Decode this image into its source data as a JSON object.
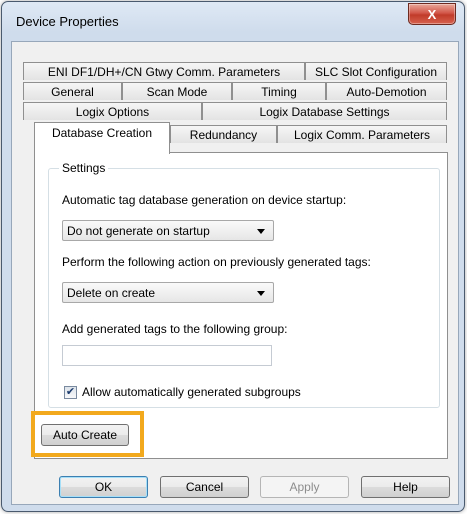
{
  "window": {
    "title": "Device Properties",
    "close_glyph": "X"
  },
  "tabs": {
    "row1": [
      "ENI DF1/DH+/CN Gtwy Comm. Parameters",
      "SLC Slot Configuration"
    ],
    "row2": [
      "General",
      "Scan Mode",
      "Timing",
      "Auto-Demotion"
    ],
    "row3": [
      "Logix Options",
      "Logix Database Settings"
    ],
    "row4": [
      "Database Creation",
      "Redundancy",
      "Logix Comm. Parameters"
    ],
    "selected": "Database Creation"
  },
  "settings": {
    "group_label": "Settings",
    "auto_generation_label": "Automatic tag database generation on device startup:",
    "auto_generation_value": "Do not generate on startup",
    "action_label": "Perform the following action on previously generated tags:",
    "action_value": "Delete on create",
    "group_label_text": "Add generated tags to the following group:",
    "group_value": "",
    "subgroups_label": "Allow automatically generated subgroups",
    "subgroups_checked": true,
    "check_glyph": "✔"
  },
  "auto_create_button": "Auto Create",
  "footer": {
    "ok": "OK",
    "cancel": "Cancel",
    "apply": "Apply",
    "help": "Help"
  },
  "colors": {
    "highlight": "#f2a91d",
    "close": "#c13b2a"
  }
}
